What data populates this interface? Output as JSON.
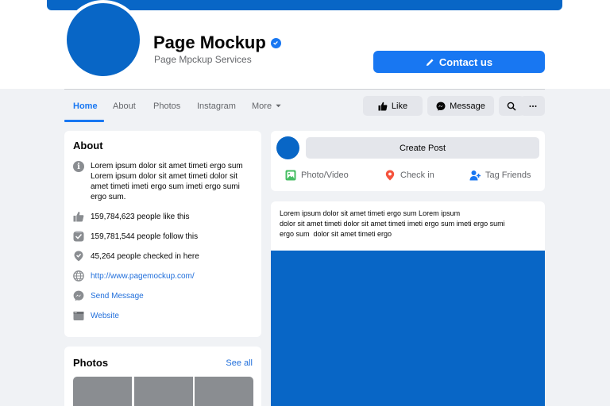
{
  "page": {
    "name": "Page Mockup",
    "category": "Page Mpckup Services"
  },
  "contact_button": {
    "label": "Contact us"
  },
  "nav": {
    "tabs": [
      {
        "label": "Home",
        "active": true
      },
      {
        "label": "About"
      },
      {
        "label": "Photos"
      },
      {
        "label": "Instagram"
      },
      {
        "label": "More"
      }
    ],
    "like_label": "Like",
    "message_label": "Message"
  },
  "about": {
    "title": "About",
    "description": "Lorem ipsum dolor sit amet timeti ergo sum Lorem ipsum dolor sit amet timeti dolor sit amet timeti imeti ergo sum imeti ergo sumi ergo sum.",
    "likes": "159,784,623 people like this",
    "follows": "159,781,544 people follow this",
    "checkins": "45,264 people checked in here",
    "url": "http://www.pagemockup.com/",
    "send_message": "Send Message",
    "website": "Website"
  },
  "photos": {
    "title": "Photos",
    "see_all": "See all"
  },
  "create_post": {
    "label": "Create Post",
    "actions": [
      {
        "label": "Photo/Video",
        "icon": "photo-icon"
      },
      {
        "label": "Check in",
        "icon": "location-pin-icon"
      },
      {
        "label": "Tag Friends",
        "icon": "tag-friends-icon"
      }
    ]
  },
  "post": {
    "line1": "Lorem ipsum dolor sit amet timeti ergo sum Lorem ipsum",
    "line2": "dolor sit amet timeti dolor sit amet timeti imeti ergo sum imeti ergo sumi",
    "line3": "ergo sum  dolor sit amet timeti ergo"
  },
  "colors": {
    "brand_blue": "#1877f2",
    "cover_blue": "#0866c6",
    "background": "#f0f2f5",
    "link": "#216fdb"
  }
}
